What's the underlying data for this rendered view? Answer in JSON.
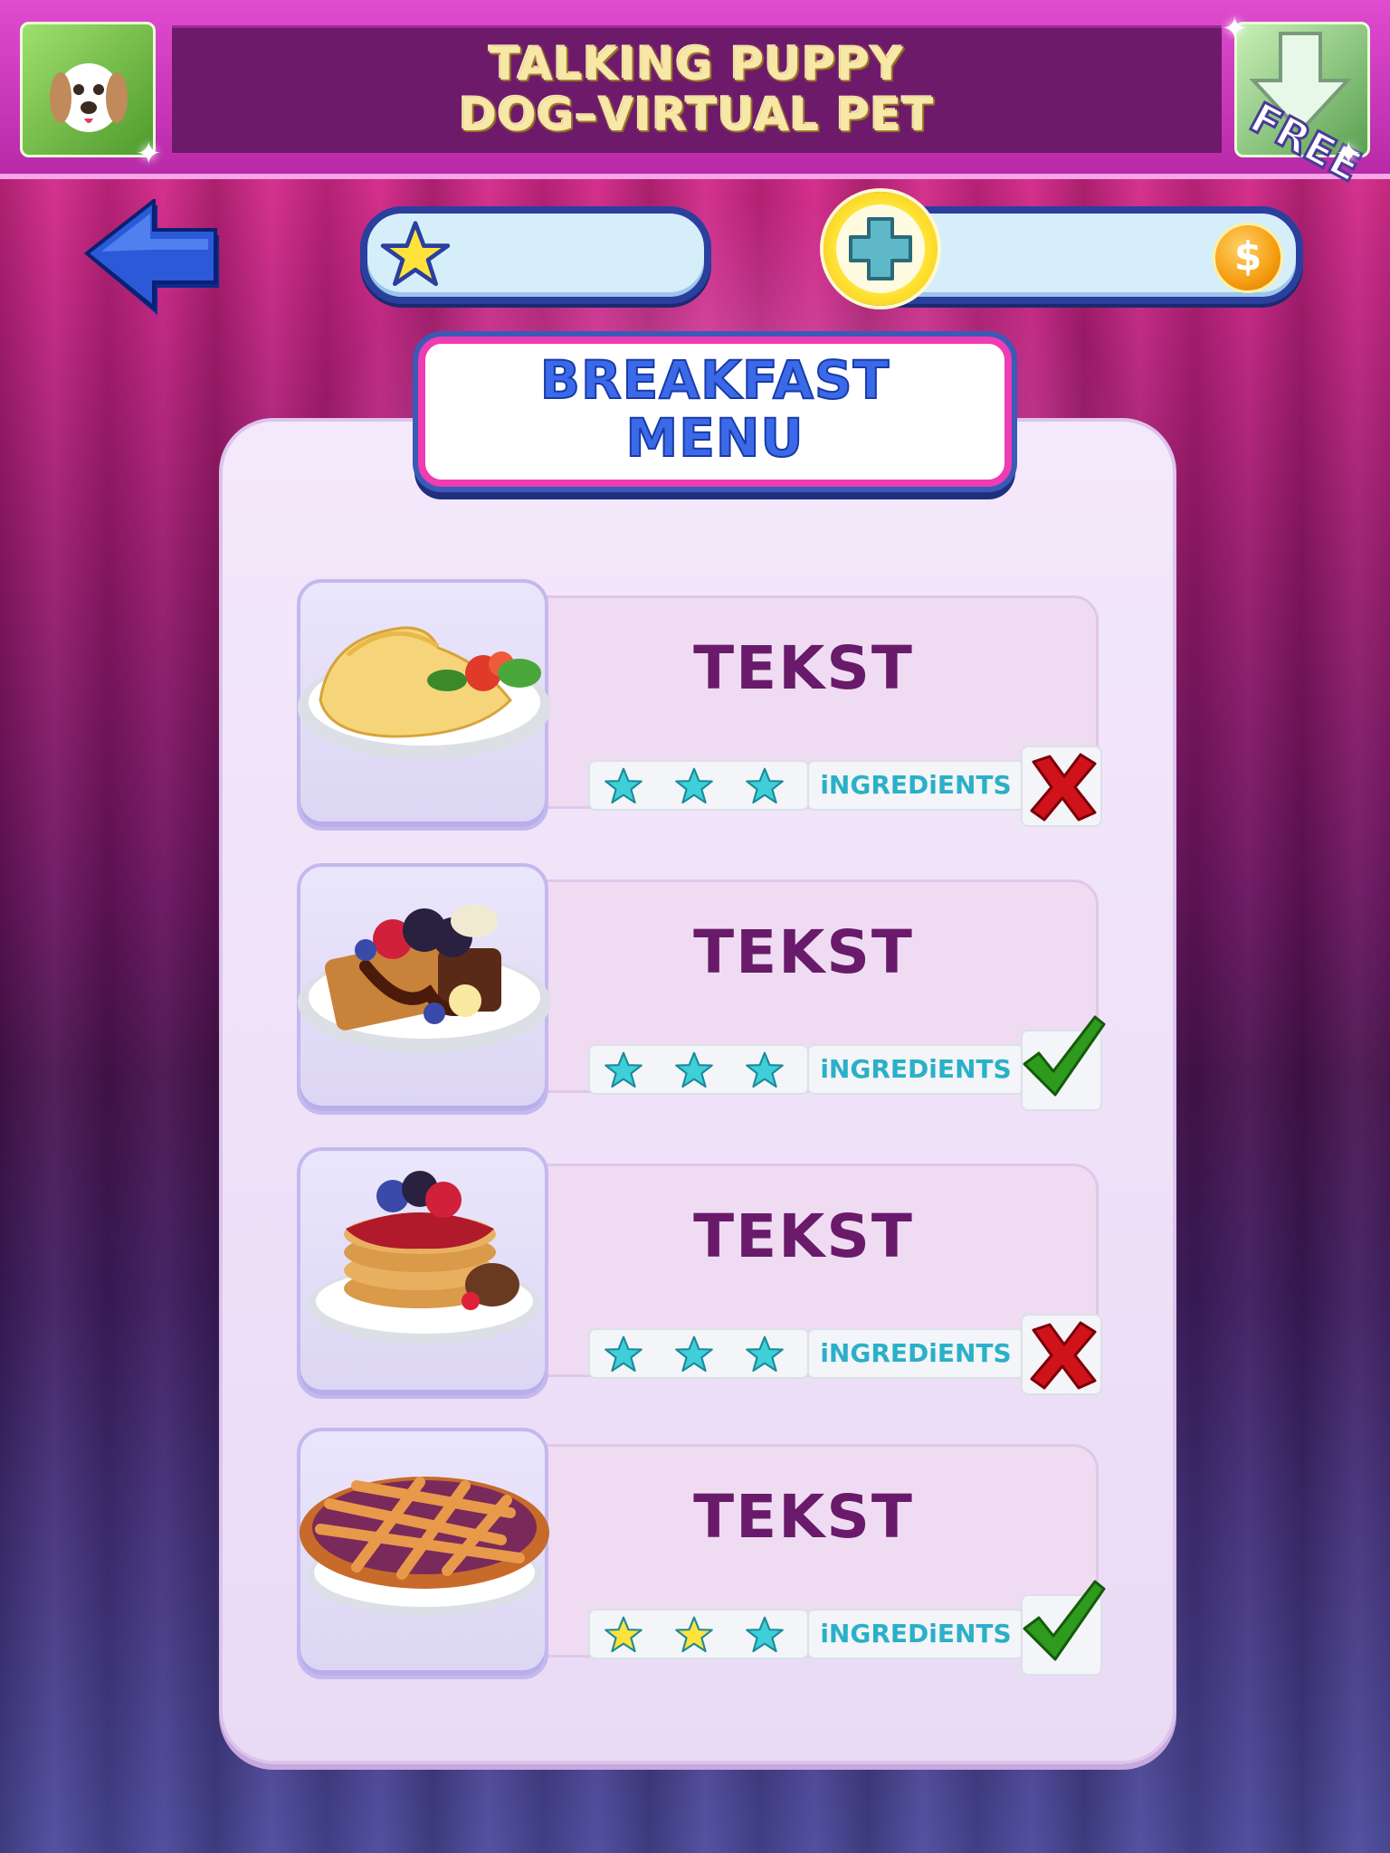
{
  "banner": {
    "title_line1": "TALKING PUPPY",
    "title_line2": "DOG–VIRTUAL PET",
    "free_label": "FREE"
  },
  "topbar": {
    "stars_value": "",
    "coins_value": ""
  },
  "title": {
    "line1": "BREAKFAST",
    "line2": "MENU"
  },
  "items": [
    {
      "name": "TEKST",
      "food_icon": "omelette-icon",
      "ingredients_label": "iNGREDiENTS",
      "stars_filled": 0,
      "status": "locked"
    },
    {
      "name": "TEKST",
      "food_icon": "waffle-icon",
      "ingredients_label": "iNGREDiENTS",
      "stars_filled": 0,
      "status": "available"
    },
    {
      "name": "TEKST",
      "food_icon": "pancakes-icon",
      "ingredients_label": "iNGREDiENTS",
      "stars_filled": 0,
      "status": "locked"
    },
    {
      "name": "TEKST",
      "food_icon": "pie-icon",
      "ingredients_label": "iNGREDiENTS",
      "stars_filled": 2,
      "status": "available"
    }
  ],
  "colors": {
    "title_blue": "#3a6ae8",
    "item_purple": "#6a1a6a",
    "ingredients_teal": "#2ab0c8",
    "star_empty": "#3ecfd8",
    "star_filled": "#ffe23a",
    "check_green": "#2e9a1e",
    "cross_red": "#d0121a"
  }
}
